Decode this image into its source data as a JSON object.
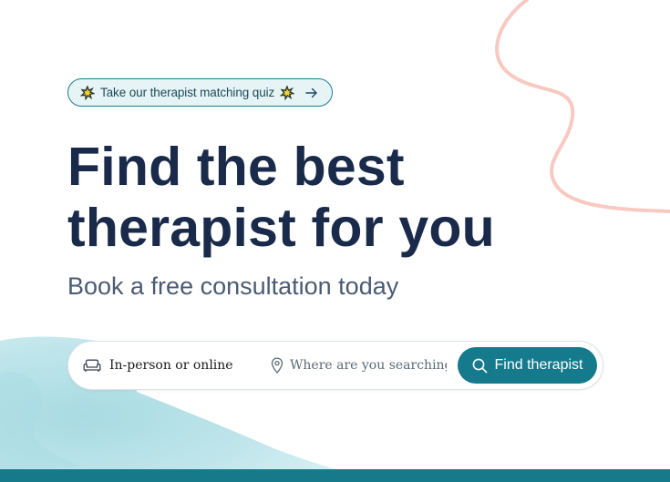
{
  "hero": {
    "quiz_link": {
      "label": "Take our therapist matching quiz",
      "icon": "sparkle-burst-icon",
      "arrow_icon": "arrow-right-icon"
    },
    "headline_line1": "Find the best",
    "headline_line2": "therapist for you",
    "subheadline": "Book a free consultation today"
  },
  "search": {
    "mode_label": "In-person or online",
    "mode_icon": "sofa-icon",
    "location_icon": "map-pin-icon",
    "location_placeholder": "Where are you searching?",
    "location_value": "",
    "button_label": "Find therapist",
    "button_icon": "search-icon"
  },
  "colors": {
    "brand_teal": "#157a8c",
    "headline_navy": "#1a2a4a",
    "subhead_slate": "#4a5b73",
    "pill_background": "#e6f4f6",
    "accent_pink": "#f7c9c0",
    "wash_blue": "#8fd0da"
  }
}
